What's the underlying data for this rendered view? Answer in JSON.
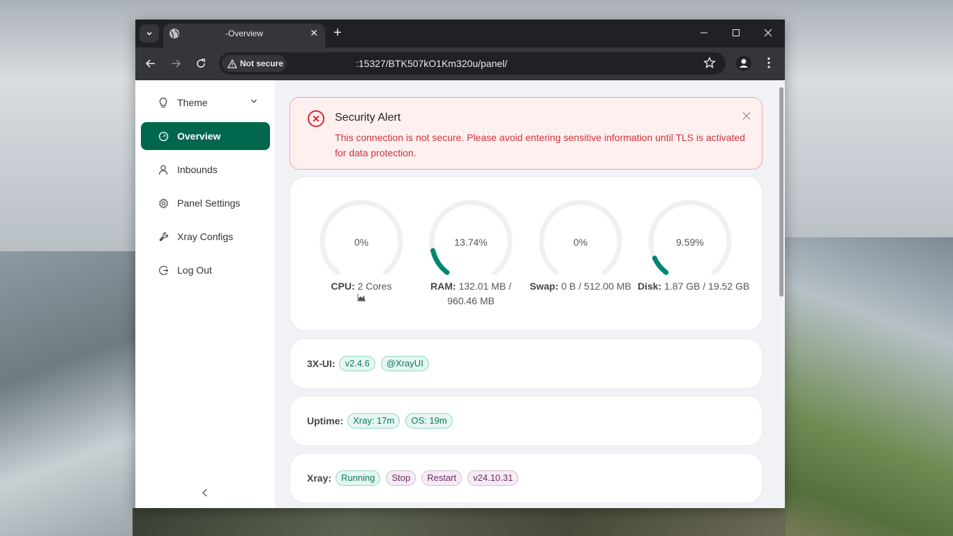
{
  "browser": {
    "tab_title": "-Overview",
    "security_chip": "Not secure",
    "url": ":15327/BTK507kO1Km320u/panel/"
  },
  "sidebar": {
    "theme_label": "Theme",
    "items": [
      {
        "label": "Overview",
        "icon": "dashboard-icon",
        "active": true
      },
      {
        "label": "Inbounds",
        "icon": "user-icon"
      },
      {
        "label": "Panel Settings",
        "icon": "gear-icon"
      },
      {
        "label": "Xray Configs",
        "icon": "wrench-icon"
      },
      {
        "label": "Log Out",
        "icon": "logout-icon"
      }
    ]
  },
  "alert": {
    "title": "Security Alert",
    "description": "This connection is not secure. Please avoid entering sensitive information until TLS is activated for data protection."
  },
  "gauges": [
    {
      "value_text": "0%",
      "percent": 0,
      "label": "CPU:",
      "detail": " 2 Cores"
    },
    {
      "value_text": "13.74%",
      "percent": 13.74,
      "label": "RAM:",
      "detail": " 132.01 MB / 960.46 MB"
    },
    {
      "value_text": "0%",
      "percent": 0,
      "label": "Swap:",
      "detail": " 0 B / 512.00 MB"
    },
    {
      "value_text": "9.59%",
      "percent": 9.59,
      "label": "Disk:",
      "detail": " 1.87 GB / 19.52 GB"
    }
  ],
  "info": {
    "version_label": "3X-UI:",
    "version": "v2.4.6",
    "channel": "@XrayUI",
    "uptime_label": "Uptime:",
    "uptime_xray": "Xray: 17m",
    "uptime_os": "OS: 19m",
    "xray_label": "Xray:",
    "xray_status": "Running",
    "xray_stop": "Stop",
    "xray_restart": "Restart",
    "xray_version": "v24.10.31"
  },
  "colors": {
    "accent": "#00674d",
    "gauge_fill": "#008771",
    "gauge_track": "#f0f0f0",
    "alert_text": "#d0303a"
  }
}
